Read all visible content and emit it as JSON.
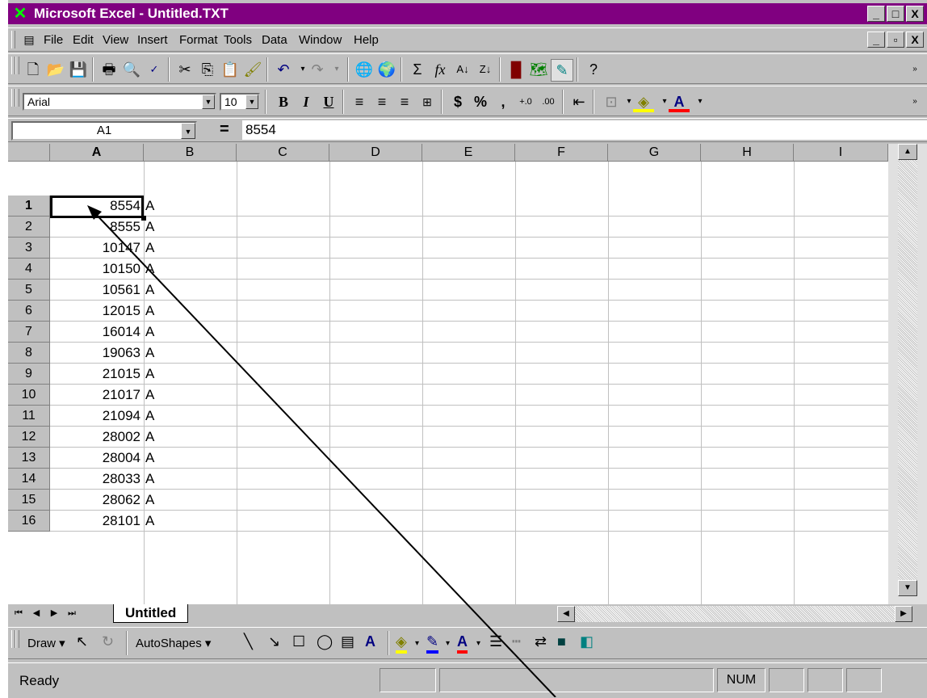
{
  "window": {
    "title": "Microsoft Excel - Untitled.TXT",
    "minimize": "_",
    "restore": "□",
    "close": "X"
  },
  "menubar": {
    "items": [
      "File",
      "Edit",
      "View",
      "Insert",
      "Format",
      "Tools",
      "Data",
      "Window",
      "Help"
    ],
    "doc_buttons": [
      "_",
      "▫",
      "X"
    ]
  },
  "format_toolbar": {
    "font": "Arial",
    "size": "10"
  },
  "formula_bar": {
    "cell_ref": "A1",
    "equals": "=",
    "value": "8554"
  },
  "columns": [
    "A",
    "B",
    "C",
    "D",
    "E",
    "F",
    "G",
    "H",
    "I"
  ],
  "rows": [
    {
      "n": "1",
      "a": "8554",
      "b": "A"
    },
    {
      "n": "2",
      "a": "8555",
      "b": "A"
    },
    {
      "n": "3",
      "a": "10147",
      "b": "A"
    },
    {
      "n": "4",
      "a": "10150",
      "b": "A"
    },
    {
      "n": "5",
      "a": "10561",
      "b": "A"
    },
    {
      "n": "6",
      "a": "12015",
      "b": "A"
    },
    {
      "n": "7",
      "a": "16014",
      "b": "A"
    },
    {
      "n": "8",
      "a": "19063",
      "b": "A"
    },
    {
      "n": "9",
      "a": "21015",
      "b": "A"
    },
    {
      "n": "10",
      "a": "21017",
      "b": "A"
    },
    {
      "n": "11",
      "a": "21094",
      "b": "A"
    },
    {
      "n": "12",
      "a": "28002",
      "b": "A"
    },
    {
      "n": "13",
      "a": "28004",
      "b": "A"
    },
    {
      "n": "14",
      "a": "28033",
      "b": "A"
    },
    {
      "n": "15",
      "a": "28062",
      "b": "A"
    },
    {
      "n": "16",
      "a": "28101",
      "b": "A"
    }
  ],
  "sheet": {
    "tab": "Untitled"
  },
  "draw_toolbar": {
    "draw": "Draw",
    "autoshapes": "AutoShapes"
  },
  "status": {
    "ready": "Ready",
    "num": "NUM"
  },
  "icons": {
    "app": "excel-icon",
    "new": "new-icon",
    "open": "open-icon",
    "save": "save-icon"
  }
}
